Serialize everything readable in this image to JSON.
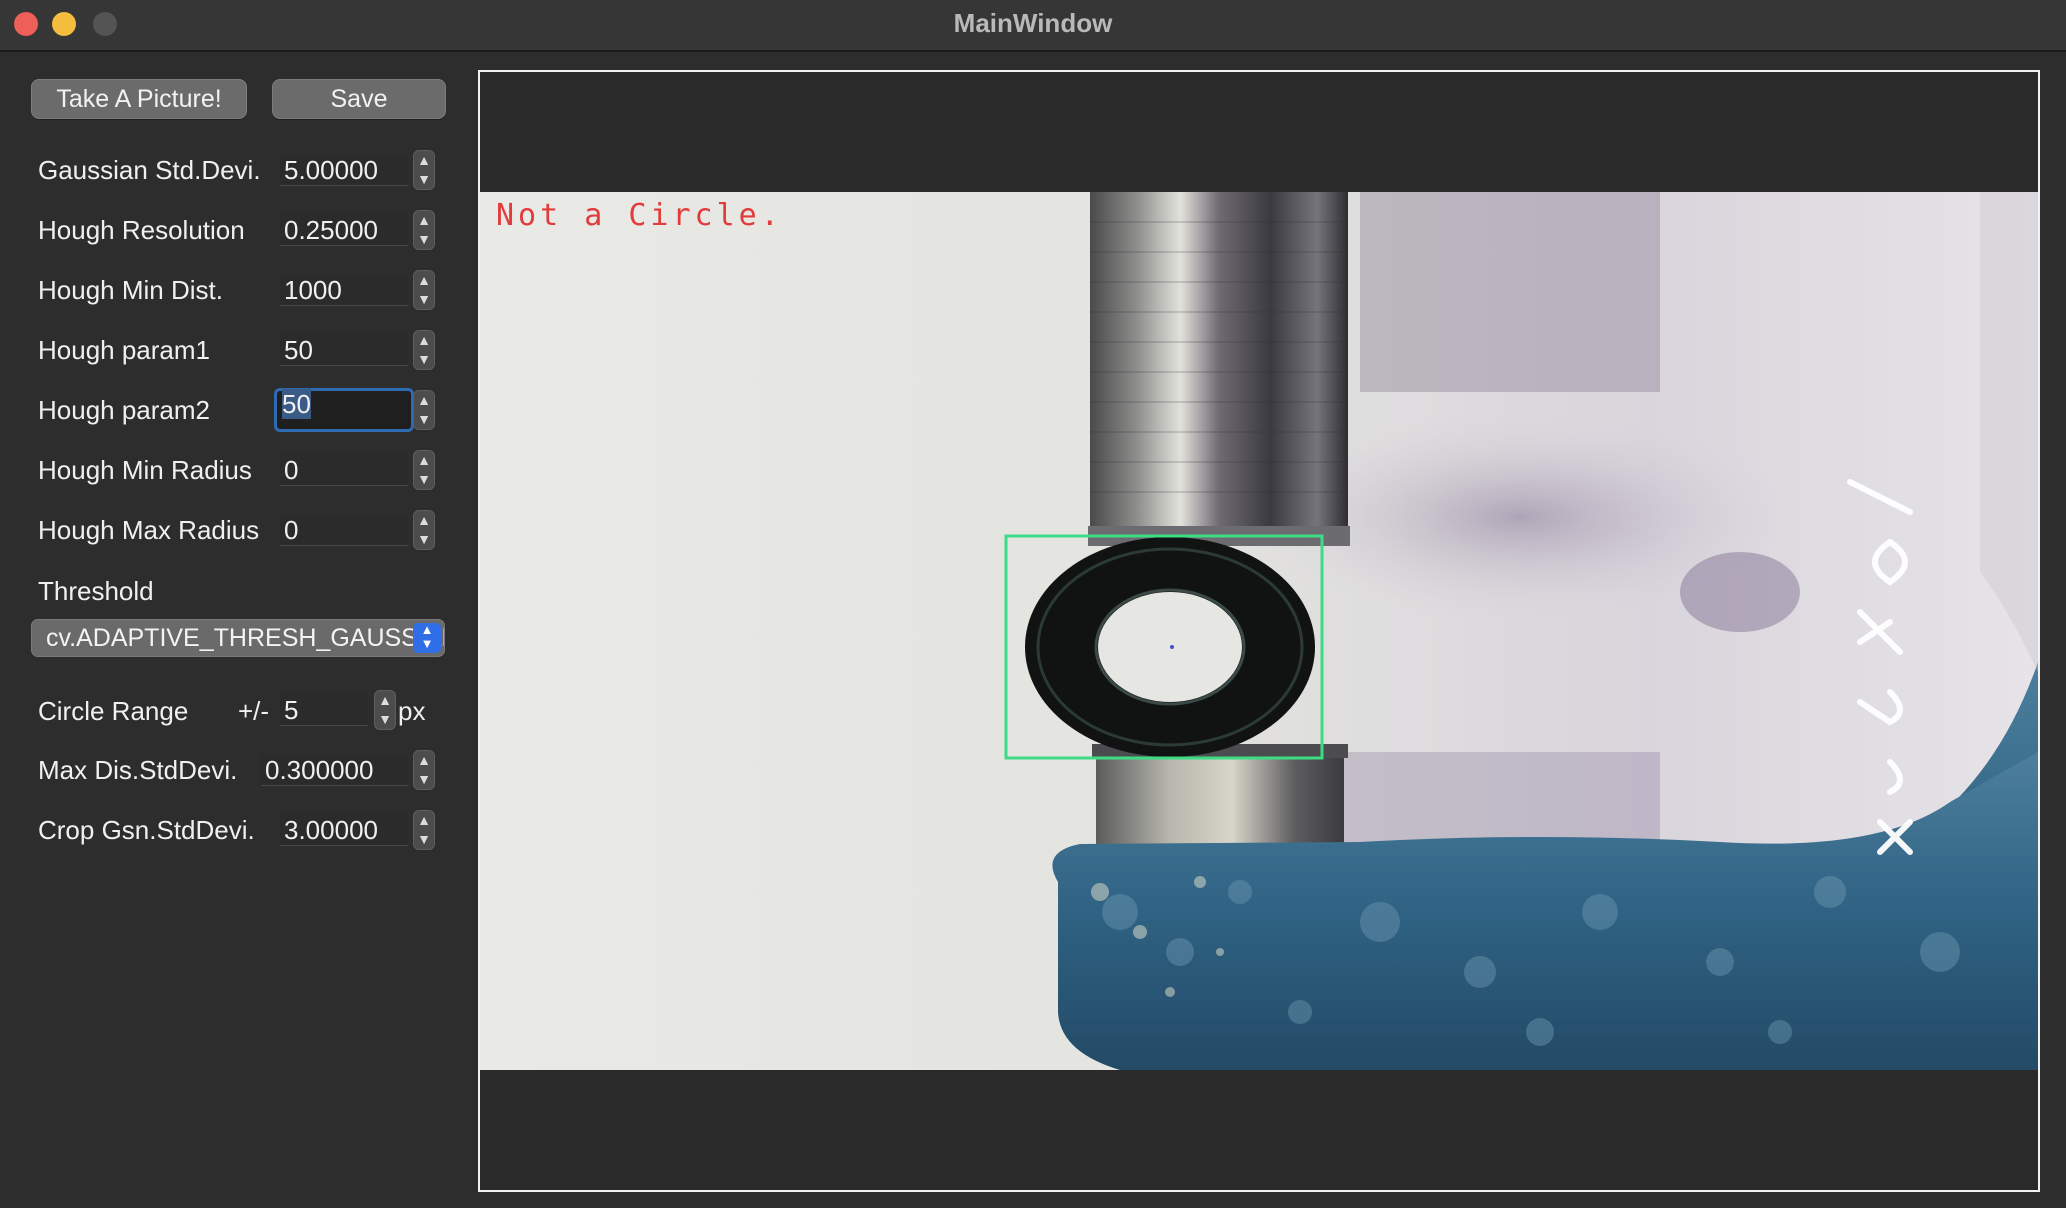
{
  "window": {
    "title": "MainWindow"
  },
  "toolbar": {
    "take_picture_label": "Take A Picture!",
    "save_label": "Save"
  },
  "params": [
    {
      "label": "Gaussian Std.Devi.",
      "value": "5.00000"
    },
    {
      "label": "Hough Resolution",
      "value": "0.25000"
    },
    {
      "label": "Hough Min Dist.",
      "value": "1000"
    },
    {
      "label": "Hough param1",
      "value": "50"
    },
    {
      "label": "Hough param2",
      "value": "50"
    },
    {
      "label": "Hough Min Radius",
      "value": "0"
    },
    {
      "label": "Hough Max Radius",
      "value": "0"
    }
  ],
  "threshold": {
    "label": "Threshold",
    "selected": "cv.ADAPTIVE_THRESH_GAUSSIAN_C"
  },
  "circle_range": {
    "label": "Circle Range",
    "prefix": "+/-",
    "value": "5",
    "unit": "px"
  },
  "extra_params": [
    {
      "label": "Max Dis.StdDevi.",
      "value": "0.300000"
    },
    {
      "label": "Crop Gsn.StdDevi.",
      "value": "3.00000"
    }
  ],
  "image_view": {
    "overlay_text": "Not a Circle.",
    "detection_box_color": "#3ddc84",
    "overlay_text_color": "#e23b3b",
    "rotated_handwriting": "ø 4.5 fem"
  }
}
